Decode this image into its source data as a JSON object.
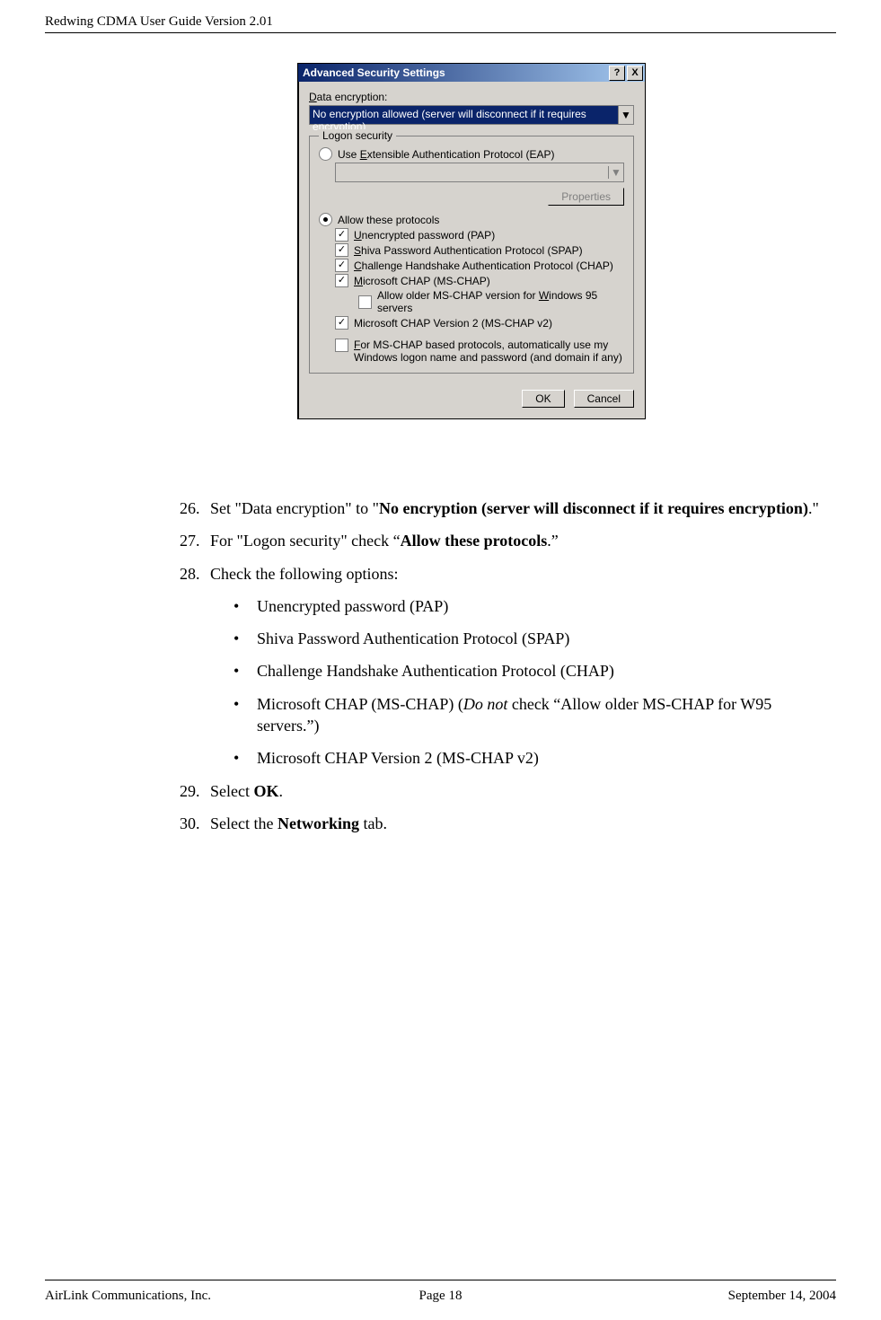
{
  "header": "Redwing CDMA User Guide Version 2.01",
  "footer": {
    "left": "AirLink Communications, Inc.",
    "center": "Page 18",
    "right": "September 14, 2004"
  },
  "dlg": {
    "title": "Advanced Security Settings",
    "help": "?",
    "close": "X",
    "enc_label_pre": "D",
    "enc_label_post": "ata encryption:",
    "enc_value": "No encryption allowed (server will disconnect if it requires encryption)",
    "fieldset": "Logon security",
    "eap_pre": "Use ",
    "eap_u": "E",
    "eap_post": "xtensible Authentication Protocol (EAP)",
    "props_btn": "Properties",
    "allow": "Allow these protocols",
    "pap_u": "U",
    "pap_post": "nencrypted password (PAP)",
    "spap_u": "S",
    "spap_post": "hiva Password Authentication Protocol (SPAP)",
    "chap_u": "C",
    "chap_post": "hallenge Handshake Authentication Protocol (CHAP)",
    "mschap_u": "M",
    "mschap_post": "icrosoft CHAP (MS-CHAP)",
    "older_pre": "Allow older MS-CHAP version for ",
    "older_u": "W",
    "older_post": "indows 95 servers",
    "v2": "Microsoft CHAP Version 2 (MS-CHAP v2)",
    "logon_u": "F",
    "logon_post": "or MS-CHAP based protocols, automatically use my Windows logon name and password (and domain if any)",
    "ok": "OK",
    "cancel": "Cancel",
    "dd": "▼"
  },
  "t": {
    "n26": "26.",
    "s26a": "Set \"Data encryption\" to \"",
    "s26b": "No encryption (server will disconnect if it requires encryption)",
    "s26c": ".\"",
    "n27": "27.",
    "s27a": "For \"Logon security\" check “",
    "s27b": "Allow these protocols",
    "s27c": ".”",
    "n28": "28.",
    "s28": "Check the following options:",
    "b1": "Unencrypted password (PAP)",
    "b2": "Shiva Password Authentication Protocol (SPAP)",
    "b3": "Challenge Handshake Authentication Protocol (CHAP)",
    "b4a": "Microsoft CHAP (MS-CHAP) (",
    "b4i": "Do not",
    "b4b": " check “Allow older MS-CHAP for W95 servers.”)",
    "b5": "Microsoft CHAP Version 2 (MS-CHAP v2)",
    "n29": "29.",
    "s29a": "Select ",
    "s29b": "OK",
    "s29c": ".",
    "n30": "30.",
    "s30a": "Select the ",
    "s30b": "Networking",
    "s30c": " tab.",
    "bullet": "•"
  }
}
